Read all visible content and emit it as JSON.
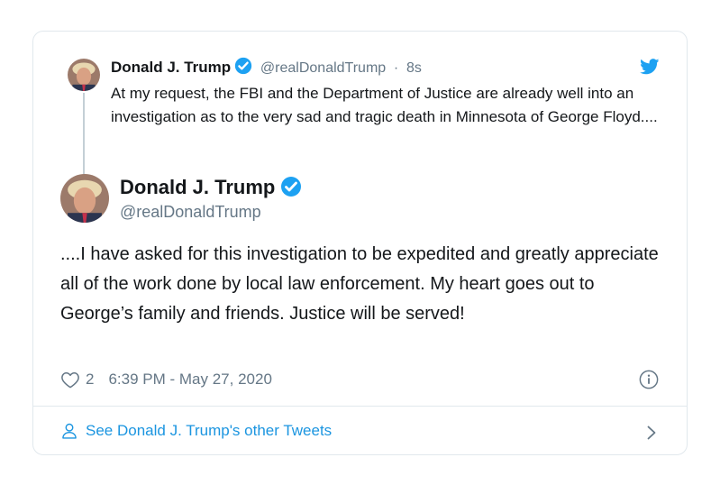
{
  "parent_tweet": {
    "name": "Donald J. Trump",
    "handle": "@realDonaldTrump",
    "time_sep": "·",
    "time": "8s",
    "text": "At my request, the FBI and the Department of Justice are already well into an investigation as to the very sad and tragic death in Minnesota of George Floyd...."
  },
  "main_tweet": {
    "name": "Donald J. Trump",
    "handle": "@realDonaldTrump",
    "text": "....I have asked for this investigation to be expedited and greatly appreciate all of the work done by local law enforcement. My heart goes out to George’s family and friends. Justice will be served!",
    "likes": "2",
    "timestamp": "6:39 PM - May 27, 2020"
  },
  "footer": {
    "link_text": "See Donald J. Trump's other Tweets"
  },
  "icons": {
    "brand": "twitter-bird-icon",
    "verified": "verified-badge-icon",
    "like": "heart-icon",
    "info": "info-icon",
    "profile": "person-icon",
    "more": "chevron-right-icon"
  },
  "colors": {
    "brand_blue": "#1da1f2",
    "link_blue": "#1b95e0",
    "secondary_text": "#657786",
    "border": "#e1e8ed"
  }
}
